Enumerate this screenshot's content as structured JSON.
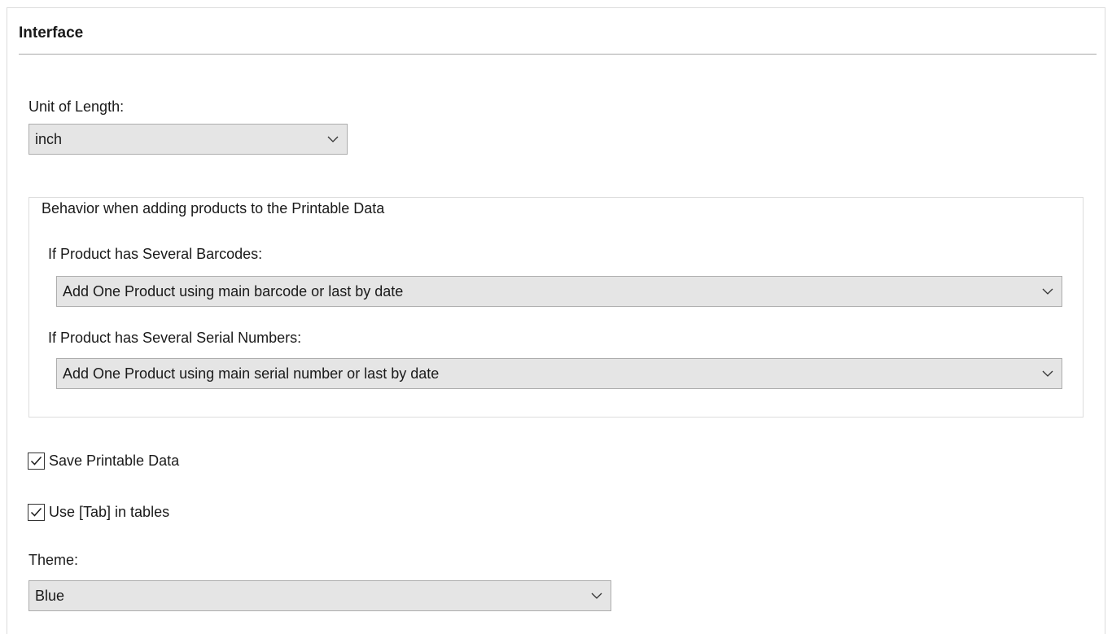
{
  "interface": {
    "title": "Interface"
  },
  "unit_of_length": {
    "label": "Unit of Length:",
    "value": "inch"
  },
  "behavior_group": {
    "legend": "Behavior when adding products to the Printable Data",
    "barcodes": {
      "label": "If Product has Several Barcodes:",
      "value": "Add One Product using main barcode or last by date"
    },
    "serials": {
      "label": "If Product has Several Serial Numbers:",
      "value": "Add One Product using main serial number or last by date"
    }
  },
  "options": {
    "save_printable_data": {
      "label": "Save Printable Data",
      "checked": true
    },
    "use_tab": {
      "label": "Use [Tab] in tables",
      "checked": true
    }
  },
  "theme": {
    "label": "Theme:",
    "value": "Blue"
  },
  "icons": {
    "dropdown": "chevron-down-icon",
    "check": "checkmark-icon"
  },
  "colors": {
    "combo_background": "#e5e5e5",
    "combo_border": "#adadad",
    "rule": "#a8a8a8"
  }
}
